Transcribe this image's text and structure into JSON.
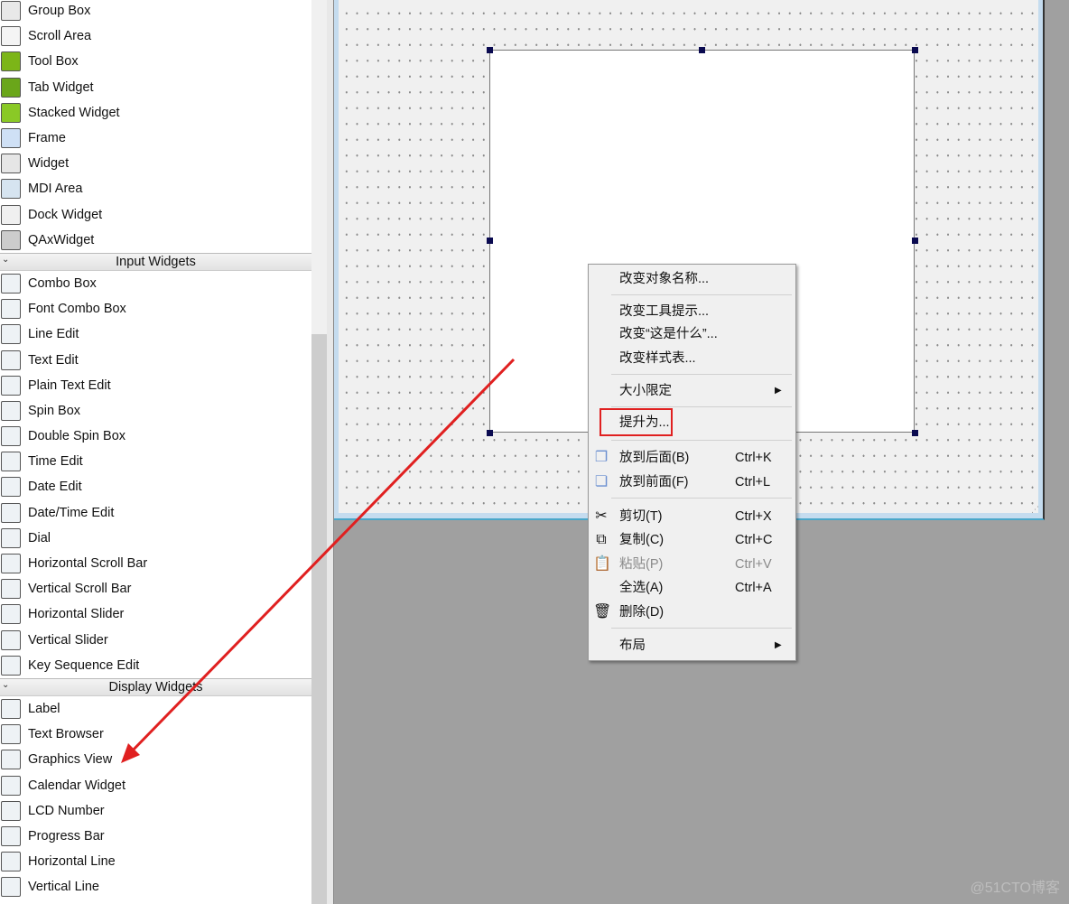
{
  "widget_box": {
    "containers": [
      {
        "label": "Group Box",
        "icon": "group-box-icon"
      },
      {
        "label": "Scroll Area",
        "icon": "scroll-area-icon"
      },
      {
        "label": "Tool Box",
        "icon": "tool-box-icon"
      },
      {
        "label": "Tab Widget",
        "icon": "tab-widget-icon"
      },
      {
        "label": "Stacked Widget",
        "icon": "stacked-widget-icon"
      },
      {
        "label": "Frame",
        "icon": "frame-icon"
      },
      {
        "label": "Widget",
        "icon": "widget-icon"
      },
      {
        "label": "MDI Area",
        "icon": "mdi-area-icon"
      },
      {
        "label": "Dock Widget",
        "icon": "dock-widget-icon"
      },
      {
        "label": "QAxWidget",
        "icon": "qaxwidget-icon"
      }
    ],
    "input_header": "Input Widgets",
    "input": [
      {
        "label": "Combo Box"
      },
      {
        "label": "Font Combo Box"
      },
      {
        "label": "Line Edit"
      },
      {
        "label": "Text Edit"
      },
      {
        "label": "Plain Text Edit"
      },
      {
        "label": "Spin Box"
      },
      {
        "label": "Double Spin Box"
      },
      {
        "label": "Time Edit"
      },
      {
        "label": "Date Edit"
      },
      {
        "label": "Date/Time Edit"
      },
      {
        "label": "Dial"
      },
      {
        "label": "Horizontal Scroll Bar"
      },
      {
        "label": "Vertical Scroll Bar"
      },
      {
        "label": "Horizontal Slider"
      },
      {
        "label": "Vertical Slider"
      },
      {
        "label": "Key Sequence Edit"
      }
    ],
    "display_header": "Display Widgets",
    "display": [
      {
        "label": "Label"
      },
      {
        "label": "Text Browser"
      },
      {
        "label": "Graphics View"
      },
      {
        "label": "Calendar Widget"
      },
      {
        "label": "LCD Number"
      },
      {
        "label": "Progress Bar"
      },
      {
        "label": "Horizontal Line"
      },
      {
        "label": "Vertical Line"
      }
    ]
  },
  "context_menu": {
    "change_object_name": "改变对象名称...",
    "change_tooltip": "改变工具提示...",
    "change_whats_this": "改变“这是什么”...",
    "change_stylesheet": "改变样式表...",
    "size_constraints": "大小限定",
    "promote_to": "提升为...",
    "send_to_back": "放到后面(B)",
    "send_to_back_key": "Ctrl+K",
    "bring_to_front": "放到前面(F)",
    "bring_to_front_key": "Ctrl+L",
    "cut": "剪切(T)",
    "cut_key": "Ctrl+X",
    "copy": "复制(C)",
    "copy_key": "Ctrl+C",
    "paste": "粘贴(P)",
    "paste_key": "Ctrl+V",
    "select_all": "全选(A)",
    "select_all_key": "Ctrl+A",
    "delete": "删除(D)",
    "layout": "布局"
  },
  "watermark": "@51CTO博客",
  "colors": {
    "annotation": "#e02020",
    "canvas": "#a0a0a0",
    "handle": "#0a0a50"
  }
}
